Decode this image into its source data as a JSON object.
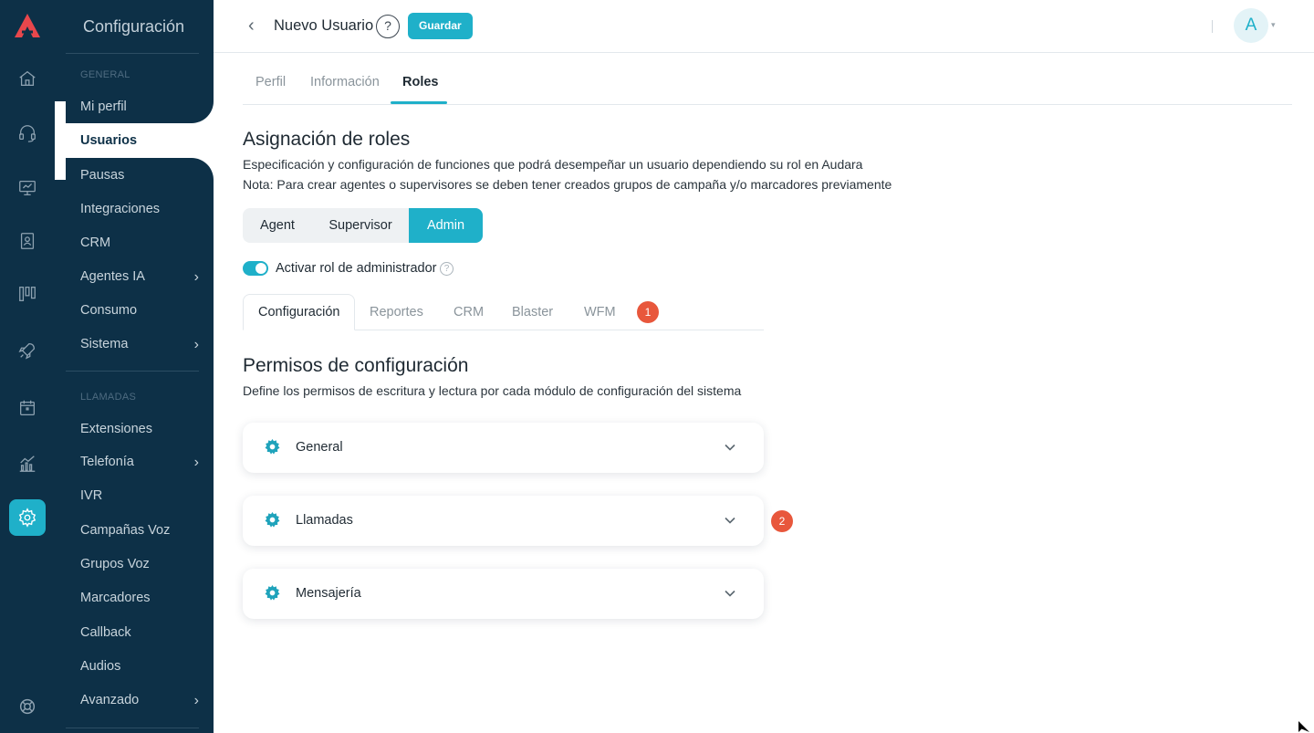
{
  "menu": {
    "title": "Configuración",
    "section_general": "GENERAL",
    "section_calls": "LLAMADAS",
    "items_general": [
      {
        "label": "Mi perfil",
        "chevron": false
      },
      {
        "label": "Usuarios",
        "chevron": false,
        "active": true
      },
      {
        "label": "Pausas",
        "chevron": false
      },
      {
        "label": "Integraciones",
        "chevron": false
      },
      {
        "label": "CRM",
        "chevron": false
      },
      {
        "label": "Agentes IA",
        "chevron": true
      },
      {
        "label": "Consumo",
        "chevron": false
      },
      {
        "label": "Sistema",
        "chevron": true
      }
    ],
    "items_calls": [
      {
        "label": "Extensiones",
        "chevron": false
      },
      {
        "label": "Telefonía",
        "chevron": true
      },
      {
        "label": "IVR",
        "chevron": false
      },
      {
        "label": "Campañas Voz",
        "chevron": false
      },
      {
        "label": "Grupos Voz",
        "chevron": false
      },
      {
        "label": "Marcadores",
        "chevron": false
      },
      {
        "label": "Callback",
        "chevron": false
      },
      {
        "label": "Audios",
        "chevron": false
      },
      {
        "label": "Avanzado",
        "chevron": true
      }
    ],
    "chevron_glyph": "›"
  },
  "rail": {
    "icons": [
      "home-icon",
      "headset-icon",
      "monitor-icon",
      "contact-book-icon",
      "kanban-icon",
      "rocket-icon",
      "calendar-icon",
      "analytics-icon",
      "settings-icon",
      "support-icon"
    ],
    "active": "settings-icon"
  },
  "header": {
    "back_glyph": "‹",
    "title": "Nuevo Usuario",
    "help_glyph": "?",
    "save_label": "Guardar",
    "avatar_initial": "A",
    "avatar_caret": "▾"
  },
  "tabs": [
    {
      "label": "Perfil"
    },
    {
      "label": "Información"
    },
    {
      "label": "Roles",
      "active": true
    }
  ],
  "roles": {
    "title": "Asignación de roles",
    "description": "Especificación y configuración de funciones que podrá desempeñar un usuario dependiendo su rol en Audara",
    "note": "Nota: Para crear agentes o supervisores se deben tener creados grupos de campaña y/o marcadores previamente",
    "options": [
      {
        "label": "Agent"
      },
      {
        "label": "Supervisor"
      },
      {
        "label": "Admin",
        "active": true
      }
    ],
    "toggle_label": "Activar rol de administrador",
    "toggle_on": true,
    "help_glyph": "?"
  },
  "subtabs": [
    {
      "label": "Configuración",
      "active": true
    },
    {
      "label": "Reportes"
    },
    {
      "label": "CRM"
    },
    {
      "label": "Blaster"
    },
    {
      "label": "WFM"
    }
  ],
  "badges": {
    "first": "1",
    "second": "2"
  },
  "permissions": {
    "title": "Permisos de configuración",
    "description": "Define los permisos de escritura y lectura por cada módulo de configuración del sistema",
    "sections": [
      {
        "label": "General"
      },
      {
        "label": "Llamadas"
      },
      {
        "label": "Mensajería"
      }
    ]
  },
  "colors": {
    "sidebar": "#0d3047",
    "accent": "#1fb0c9",
    "badge": "#e8573c",
    "logo": "#e8474c"
  }
}
